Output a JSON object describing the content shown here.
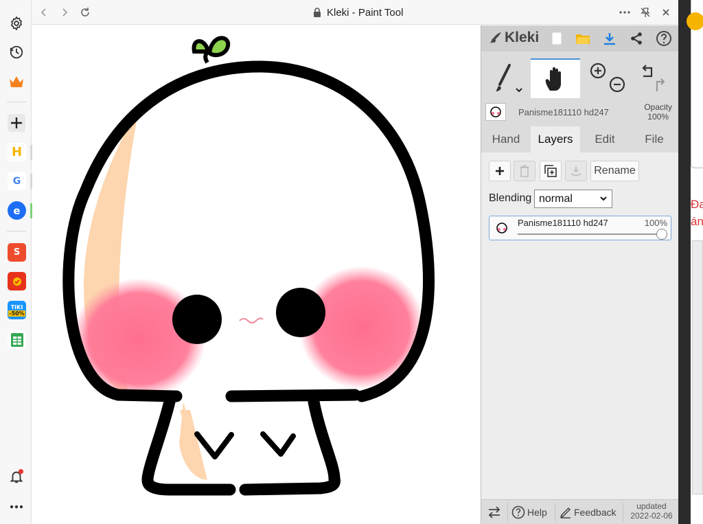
{
  "window": {
    "title": "Kleki - Paint Tool"
  },
  "left_sidebar": {
    "items": [
      {
        "name": "gear-icon"
      },
      {
        "name": "history-icon"
      },
      {
        "name": "crown-icon",
        "color": "#f5821f"
      },
      {
        "name": "plus-icon"
      },
      {
        "name": "app-h",
        "label": "H"
      },
      {
        "name": "app-google",
        "label": "G"
      },
      {
        "name": "app-messenger",
        "label": "e"
      },
      {
        "name": "app-shopee",
        "label": "S"
      },
      {
        "name": "app-lazada"
      },
      {
        "name": "app-tiki",
        "label": "TIKI",
        "sublabel": "-50%"
      },
      {
        "name": "app-sheets"
      },
      {
        "name": "bell-icon"
      },
      {
        "name": "more-icon"
      }
    ]
  },
  "panel": {
    "logo_text": "Kleki",
    "layer_name_header": "Panisme181110 hd247",
    "opacity_label": "Opacity",
    "opacity_value": "100%",
    "tabs": [
      {
        "label": "Hand",
        "active": false
      },
      {
        "label": "Layers",
        "active": true
      },
      {
        "label": "Edit",
        "active": false
      },
      {
        "label": "File",
        "active": false
      }
    ],
    "rename_label": "Rename",
    "blending_label": "Blending",
    "blending_value": "normal",
    "layer": {
      "name": "Panisme181110 hd247",
      "opacity": "100%"
    },
    "footer": {
      "help": "Help",
      "feedback": "Feedback",
      "updated_label": "updated",
      "updated_date": "2022-02-06"
    }
  },
  "right_strip": {
    "text_line1": "Đa",
    "text_line2": "án"
  },
  "colors": {
    "accent": "#4a90d9",
    "blush": "#ff6f8f",
    "skin": "#fdd5ae",
    "sprout": "#8ed34d"
  }
}
